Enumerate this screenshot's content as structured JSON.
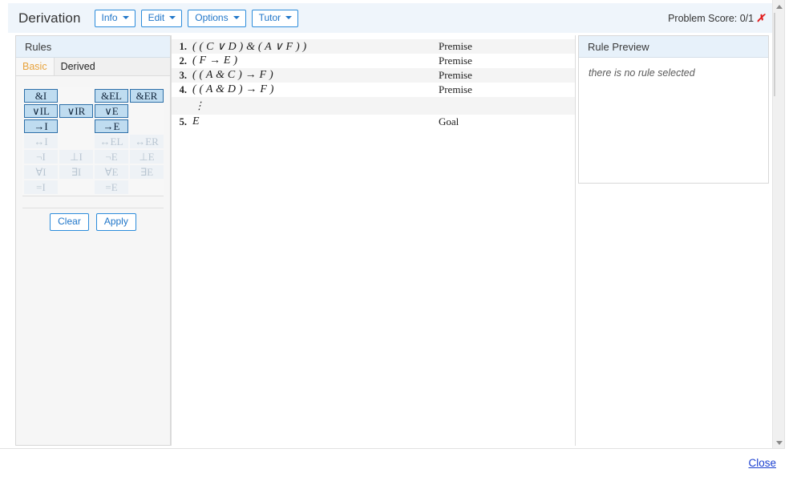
{
  "header": {
    "title": "Derivation",
    "menus": [
      {
        "label": "Info",
        "icon": "chevron-down-icon"
      },
      {
        "label": "Edit",
        "icon": "chevron-down-icon"
      },
      {
        "label": "Options",
        "icon": "chevron-down-icon"
      },
      {
        "label": "Tutor",
        "icon": "chevron-down-icon"
      }
    ],
    "score_label": "Problem Score: 0/1",
    "score_mark": "✗",
    "score_mark_color": "#e11d1d"
  },
  "rules_panel": {
    "title": "Rules",
    "tabs": [
      {
        "label": "Basic",
        "active": true
      },
      {
        "label": "Derived",
        "active": false
      }
    ],
    "grid": [
      [
        {
          "label": "&I",
          "enabled": true
        },
        {
          "label": "",
          "enabled": false,
          "blank": true
        },
        {
          "label": "&EL",
          "enabled": true
        },
        {
          "label": "&ER",
          "enabled": true
        }
      ],
      [
        {
          "label": "∨IL",
          "enabled": true
        },
        {
          "label": "∨IR",
          "enabled": true
        },
        {
          "label": "∨E",
          "enabled": true
        },
        {
          "label": "",
          "enabled": false,
          "blank": true
        }
      ],
      [
        {
          "label": "→I",
          "enabled": true
        },
        {
          "label": "",
          "enabled": false,
          "blank": true
        },
        {
          "label": "→E",
          "enabled": true
        },
        {
          "label": "",
          "enabled": false,
          "blank": true
        }
      ],
      [
        {
          "label": "↔I",
          "enabled": false
        },
        {
          "label": "",
          "enabled": false,
          "blank": true
        },
        {
          "label": "↔EL",
          "enabled": false
        },
        {
          "label": "↔ER",
          "enabled": false
        }
      ],
      [
        {
          "label": "¬I",
          "enabled": false
        },
        {
          "label": "⊥I",
          "enabled": false
        },
        {
          "label": "¬E",
          "enabled": false
        },
        {
          "label": "⊥E",
          "enabled": false
        }
      ],
      [
        {
          "label": "∀I",
          "enabled": false
        },
        {
          "label": "∃I",
          "enabled": false
        },
        {
          "label": "∀E",
          "enabled": false
        },
        {
          "label": "∃E",
          "enabled": false
        }
      ],
      [
        {
          "label": "=I",
          "enabled": false
        },
        {
          "label": "",
          "enabled": false,
          "blank": true
        },
        {
          "label": "=E",
          "enabled": false
        },
        {
          "label": "",
          "enabled": false,
          "blank": true
        }
      ]
    ],
    "clear_label": "Clear",
    "apply_label": "Apply"
  },
  "derivation": {
    "lines": [
      {
        "num": "1.",
        "formula": "( ( C ∨ D )  &  ( A ∨ F ) )",
        "justification": "Premise",
        "shaded": true
      },
      {
        "num": "2.",
        "formula": "( F → E )",
        "justification": "Premise",
        "shaded": false
      },
      {
        "num": "3.",
        "formula": "( ( A & C )  →  F )",
        "justification": "Premise",
        "shaded": true
      },
      {
        "num": "4.",
        "formula": "( ( A & D )  →  F )",
        "justification": "Premise",
        "shaded": false
      },
      {
        "num": "",
        "formula": "⋮",
        "justification": "",
        "shaded": true,
        "is_gap": true
      },
      {
        "num": "5.",
        "formula": "E",
        "justification": "Goal",
        "shaded": false
      }
    ]
  },
  "preview_panel": {
    "title": "Rule Preview",
    "message": "there is no rule selected"
  },
  "footer": {
    "close_label": "Close"
  },
  "scrollbar": {
    "up_icon": "triangle-up-icon",
    "down_icon": "triangle-down-icon"
  }
}
